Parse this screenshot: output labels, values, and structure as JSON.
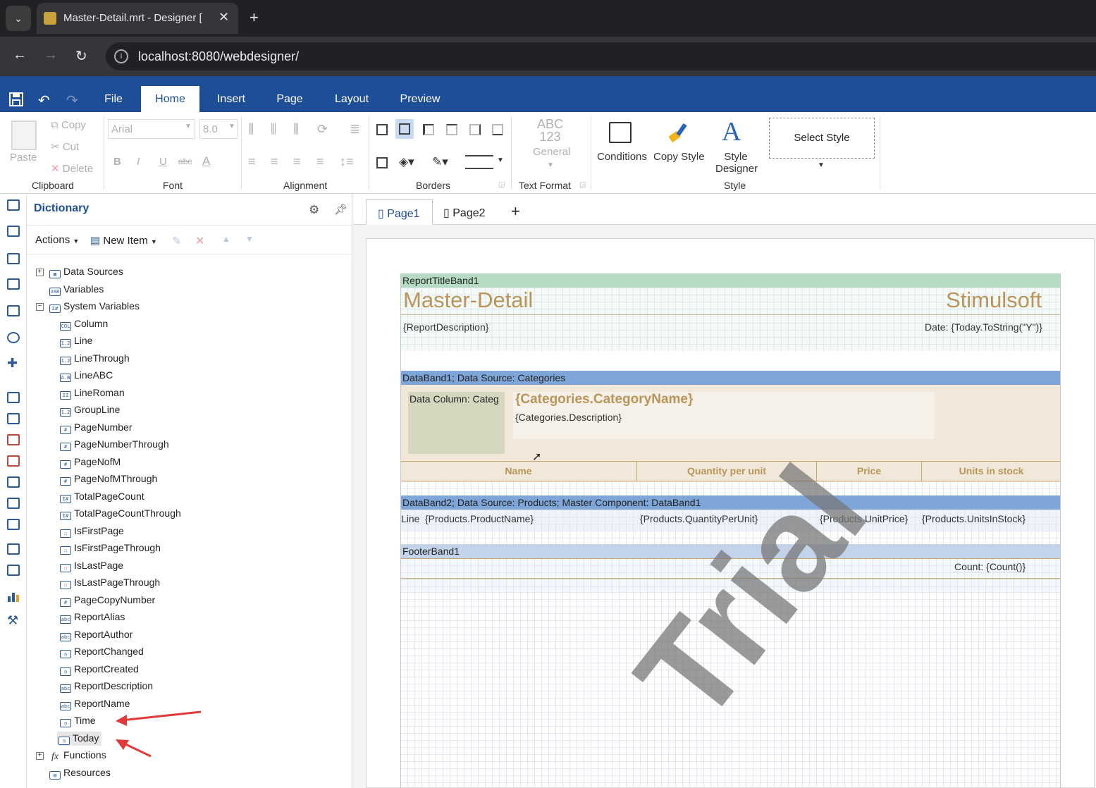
{
  "browser": {
    "tab_title": "Master-Detail.mrt - Designer [",
    "url": "localhost:8080/webdesigner/"
  },
  "ribbon": {
    "tabs": [
      "File",
      "Home",
      "Insert",
      "Page",
      "Layout",
      "Preview"
    ],
    "active_tab": "Home",
    "clipboard": {
      "paste": "Paste",
      "copy": "Copy",
      "cut": "Cut",
      "delete": "Delete",
      "label": "Clipboard"
    },
    "font": {
      "family": "Arial",
      "size": "8.0",
      "label": "Font",
      "bold": "B",
      "italic": "I",
      "underline": "U",
      "strike": "abc",
      "color": "A"
    },
    "alignment": {
      "label": "Alignment"
    },
    "borders": {
      "label": "Borders"
    },
    "text_format": {
      "icon_text": "ABC\n123",
      "general": "General",
      "label": "Text Format"
    },
    "style": {
      "conditions": "Conditions",
      "copy_style": "Copy Style",
      "style_designer": "Style Designer",
      "select_style": "Select Style",
      "label": "Style"
    }
  },
  "dictionary": {
    "title": "Dictionary",
    "actions": "Actions",
    "new_item": "New Item",
    "tree": [
      {
        "label": "Data Sources",
        "icon": "table-icon",
        "level": 0,
        "expander": "+"
      },
      {
        "label": "Variables",
        "icon": "var-icon",
        "level": 0
      },
      {
        "label": "System Variables",
        "icon": "sysvar-icon",
        "level": 0,
        "expander": "−"
      },
      {
        "label": "Column",
        "icon": "col-icon",
        "level": 1
      },
      {
        "label": "Line",
        "icon": "num-icon",
        "level": 1
      },
      {
        "label": "LineThrough",
        "icon": "num-icon",
        "level": 1
      },
      {
        "label": "LineABC",
        "icon": "abc-icon",
        "level": 1
      },
      {
        "label": "LineRoman",
        "icon": "roman-icon",
        "level": 1
      },
      {
        "label": "GroupLine",
        "icon": "num-icon",
        "level": 1
      },
      {
        "label": "PageNumber",
        "icon": "hash-icon",
        "level": 1
      },
      {
        "label": "PageNumberThrough",
        "icon": "hash-icon",
        "level": 1
      },
      {
        "label": "PageNofM",
        "icon": "hash-icon",
        "level": 1
      },
      {
        "label": "PageNofMThrough",
        "icon": "hash-icon",
        "level": 1
      },
      {
        "label": "TotalPageCount",
        "icon": "sum-icon",
        "level": 1
      },
      {
        "label": "TotalPageCountThrough",
        "icon": "sum-icon",
        "level": 1
      },
      {
        "label": "IsFirstPage",
        "icon": "bool-icon",
        "level": 1
      },
      {
        "label": "IsFirstPageThrough",
        "icon": "bool-icon",
        "level": 1
      },
      {
        "label": "IsLastPage",
        "icon": "bool-icon",
        "level": 1
      },
      {
        "label": "IsLastPageThrough",
        "icon": "bool-icon",
        "level": 1
      },
      {
        "label": "PageCopyNumber",
        "icon": "hash-icon",
        "level": 1
      },
      {
        "label": "ReportAlias",
        "icon": "string-icon",
        "level": 1
      },
      {
        "label": "ReportAuthor",
        "icon": "string-icon",
        "level": 1
      },
      {
        "label": "ReportChanged",
        "icon": "clock-icon",
        "level": 1
      },
      {
        "label": "ReportCreated",
        "icon": "clock-icon",
        "level": 1
      },
      {
        "label": "ReportDescription",
        "icon": "string-icon",
        "level": 1
      },
      {
        "label": "ReportName",
        "icon": "string-icon",
        "level": 1
      },
      {
        "label": "Time",
        "icon": "clock-icon",
        "level": 1
      },
      {
        "label": "Today",
        "icon": "clock-icon",
        "level": 1,
        "selected": true
      },
      {
        "label": "Functions",
        "icon": "fx-icon",
        "level": 0,
        "expander": "+"
      },
      {
        "label": "Resources",
        "icon": "resources-icon",
        "level": 0
      }
    ]
  },
  "page_tabs": [
    "Page1",
    "Page2"
  ],
  "report": {
    "title_band": "ReportTitleBand1",
    "title": "Master-Detail",
    "brand": "Stimulsoft",
    "description": "{ReportDescription}",
    "date": "Date: {Today.ToString(\"Y\")}",
    "databand1": "DataBand1; Data Source: Categories",
    "data_column": "Data Column: Categ",
    "category_name": "{Categories.CategoryName}",
    "category_description": "{Categories.Description}",
    "headers": [
      "Name",
      "Quantity per unit",
      "Price",
      "Units in stock"
    ],
    "databand2": "DataBand2; Data Source: Products; Master Component: DataBand1",
    "line": "Line",
    "fields": [
      "{Products.ProductName}",
      "{Products.QuantityPerUnit}",
      "{Products.UnitPrice}",
      "{Products.UnitsInStock}"
    ],
    "footer_band": "FooterBand1",
    "count": "Count: {Count()}",
    "watermark": "Trial"
  },
  "colors": {
    "ribbon_blue": "#1f4e99",
    "title_band": "#b5dcc2",
    "data_band": "#7ea6d8",
    "footer_band": "#c3d3ea",
    "gold_text": "#b9955a"
  }
}
